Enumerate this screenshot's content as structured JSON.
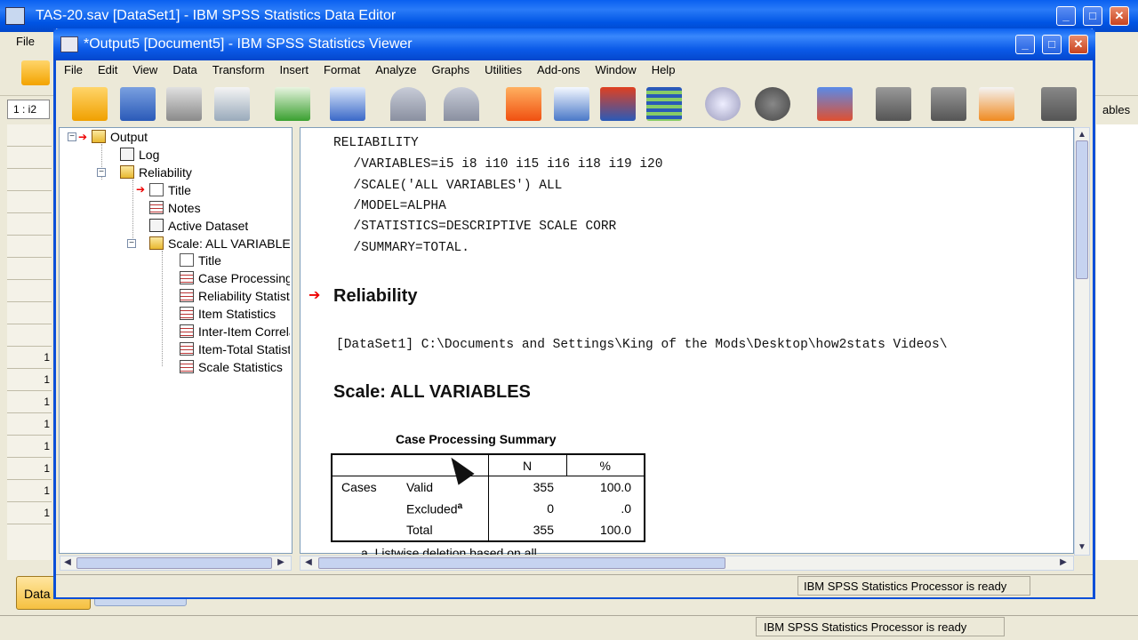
{
  "editor": {
    "title": "TAS-20.sav [DataSet1] - IBM SPSS Statistics Data Editor",
    "menu_file": "File",
    "cell_ref": "1 : i2",
    "variable_partial": "ables",
    "row_numbers": [
      "1",
      "1",
      "1",
      "1",
      "1",
      "1",
      "1",
      "1"
    ],
    "tab_data": "Data",
    "status": "IBM SPSS Statistics Processor is ready"
  },
  "viewer": {
    "title": "*Output5 [Document5] - IBM SPSS Statistics Viewer",
    "menu": [
      "File",
      "Edit",
      "View",
      "Data",
      "Transform",
      "Insert",
      "Format",
      "Analyze",
      "Graphs",
      "Utilities",
      "Add-ons",
      "Window",
      "Help"
    ],
    "toolbar_icons": [
      "open-icon",
      "save-icon",
      "print-icon",
      "print-preview-icon",
      "export-icon",
      "recall-dialog-icon",
      "undo-icon",
      "redo-icon",
      "goto-data-icon",
      "goto-case-icon",
      "goto-variable-icon",
      "variables-icon",
      "show-all-icon",
      "hide-icon",
      "insert-output-icon",
      "designate-window-icon",
      "promote-icon",
      "demote-icon",
      "script-icon",
      "display-icon"
    ],
    "outline": {
      "output": "Output",
      "log": "Log",
      "reliability": "Reliability",
      "title": "Title",
      "notes": "Notes",
      "active_dataset": "Active Dataset",
      "scale": "Scale: ALL VARIABLES",
      "scale_title": "Title",
      "case_processing": "Case Processing Summary",
      "reliability_statistics": "Reliability Statistics",
      "item_statistics": "Item Statistics",
      "inter_item": "Inter-Item Correlation Matrix",
      "item_total": "Item-Total Statistics",
      "scale_statistics": "Scale Statistics"
    },
    "syntax": [
      "RELIABILITY",
      "  /VARIABLES=i5 i8 i10 i15 i16 i18 i19 i20",
      "  /SCALE('ALL VARIABLES') ALL",
      "  /MODEL=ALPHA",
      "  /STATISTICS=DESCRIPTIVE SCALE CORR",
      "  /SUMMARY=TOTAL."
    ],
    "heading_reliability": "Reliability",
    "dataset_line": "[DataSet1] C:\\Documents and Settings\\King of the Mods\\Desktop\\how2stats Videos\\",
    "heading_scale": "Scale: ALL VARIABLES",
    "table": {
      "title": "Case Processing Summary",
      "col_n": "N",
      "col_pct": "%",
      "group": "Cases",
      "rows": [
        {
          "label": "Valid",
          "n": "355",
          "pct": "100.0"
        },
        {
          "label": "Excluded",
          "sup": "a",
          "n": "0",
          "pct": ".0"
        },
        {
          "label": "Total",
          "n": "355",
          "pct": "100.0"
        }
      ],
      "footnote": "a. Listwise deletion based on all"
    },
    "status": "IBM SPSS Statistics Processor is ready"
  }
}
